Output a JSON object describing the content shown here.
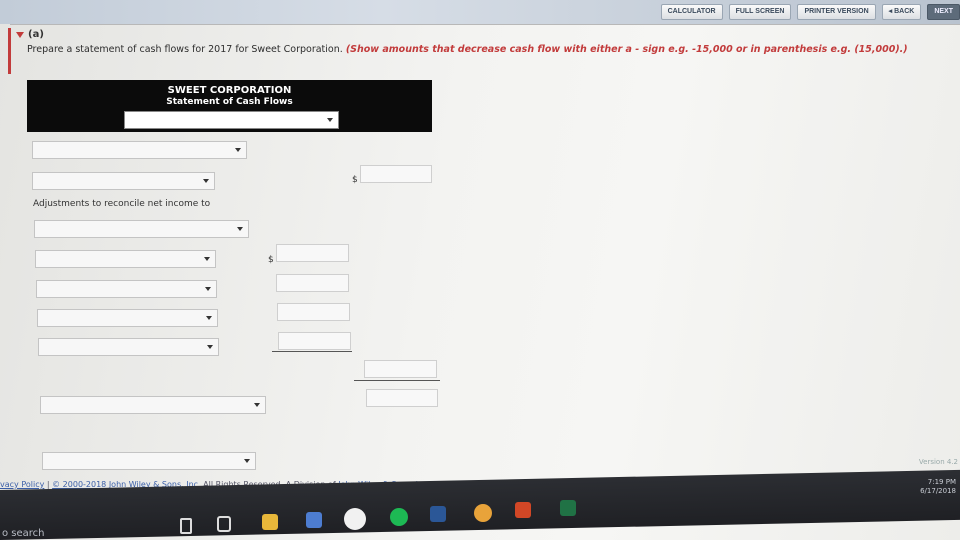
{
  "toolbar": {
    "calculator": "CALCULATOR",
    "fullscreen": "FULL SCREEN",
    "printer": "PRINTER VERSION",
    "back": "◂ BACK",
    "next": "NEXT"
  },
  "question": {
    "part": "(a)",
    "prompt": "Prepare a statement of cash flows for 2017 for Sweet Corporation.",
    "note": "(Show amounts that decrease cash flow with either a - sign e.g. -15,000 or in parenthesis e.g. (15,000).)"
  },
  "statement": {
    "company": "SWEET CORPORATION",
    "title": "Statement of Cash Flows"
  },
  "labels": {
    "adjustments": "Adjustments to reconcile net income to",
    "dollar": "$"
  },
  "version": "Version 4.2",
  "footer": {
    "policy": "vacy Policy",
    "sep": "|",
    "copyright": "© 2000-2018 John Wiley & Sons, Inc.",
    "rights": "All Rights Reserved. A Division of",
    "company": "John Wiley & Sons, Inc."
  },
  "taskbar": {
    "search": "o search",
    "time": "7:19 PM",
    "date": "6/17/2018"
  }
}
